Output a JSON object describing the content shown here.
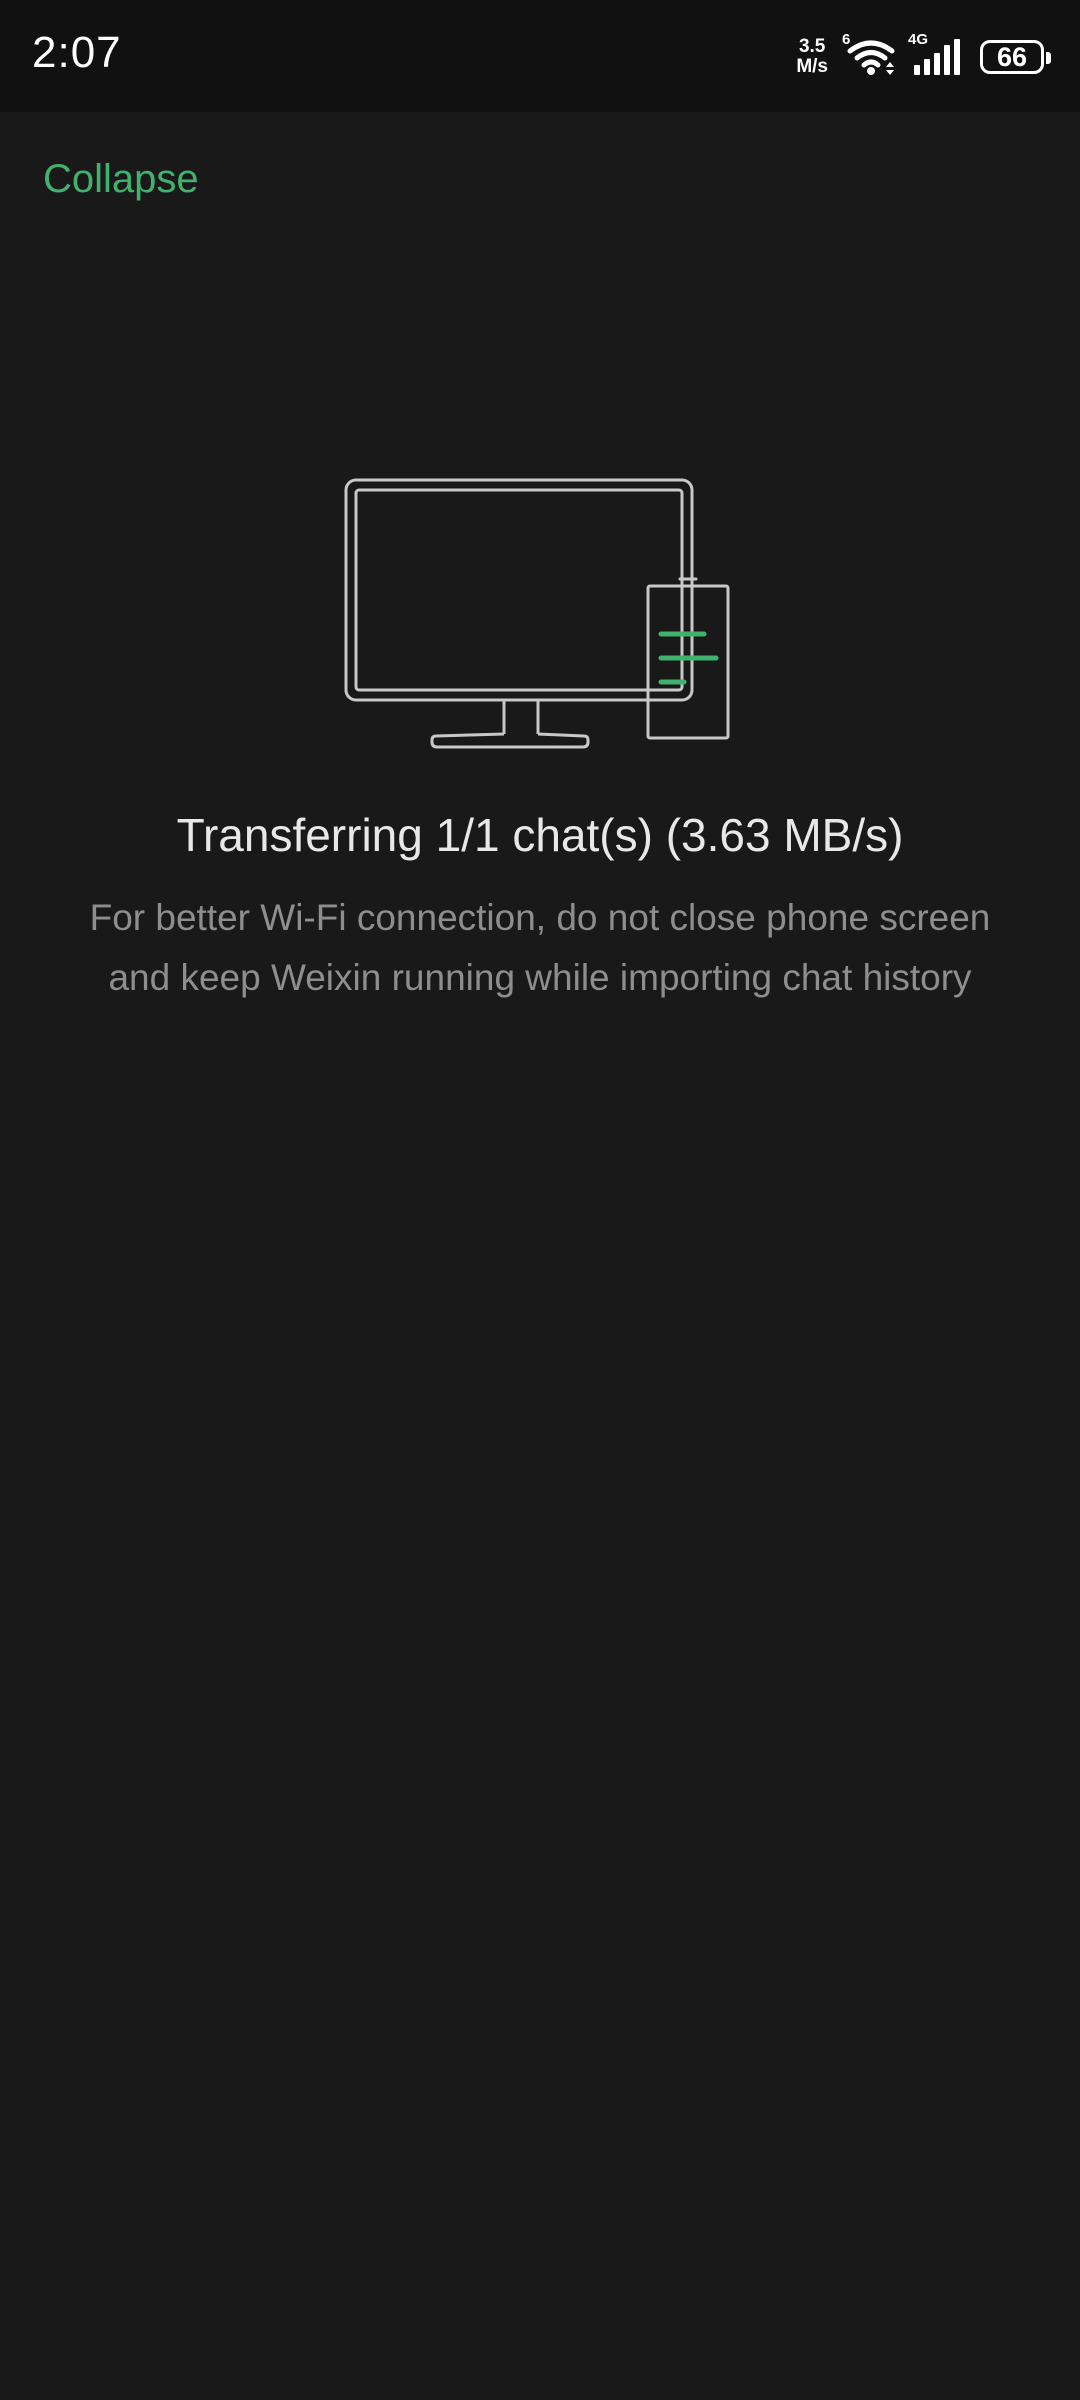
{
  "status_bar": {
    "time": "2:07",
    "net_speed_value": "3.5",
    "net_speed_unit": "M/s",
    "wifi_generation": "6",
    "cell_generation": "4G",
    "battery_level": "66",
    "battery_fill": 0.66
  },
  "header": {
    "collapse_label": "Collapse"
  },
  "transfer": {
    "title": "Transferring 1/1 chat(s) (3.63 MB/s)",
    "description": "For better Wi-Fi connection, do not close phone screen and keep Weixin running while importing chat history"
  },
  "colors": {
    "accent": "#3fb26d",
    "background": "#191919",
    "status_bar_background": "#111111",
    "title_text": "#e8e8e8",
    "secondary_text": "#8e8e8e",
    "illustration_stroke": "#c8c8c8"
  },
  "icons": {
    "illustration": "computer-and-phone-transfer-icon",
    "wifi": "wifi-icon",
    "cell": "cell-signal-icon",
    "battery": "battery-icon"
  }
}
